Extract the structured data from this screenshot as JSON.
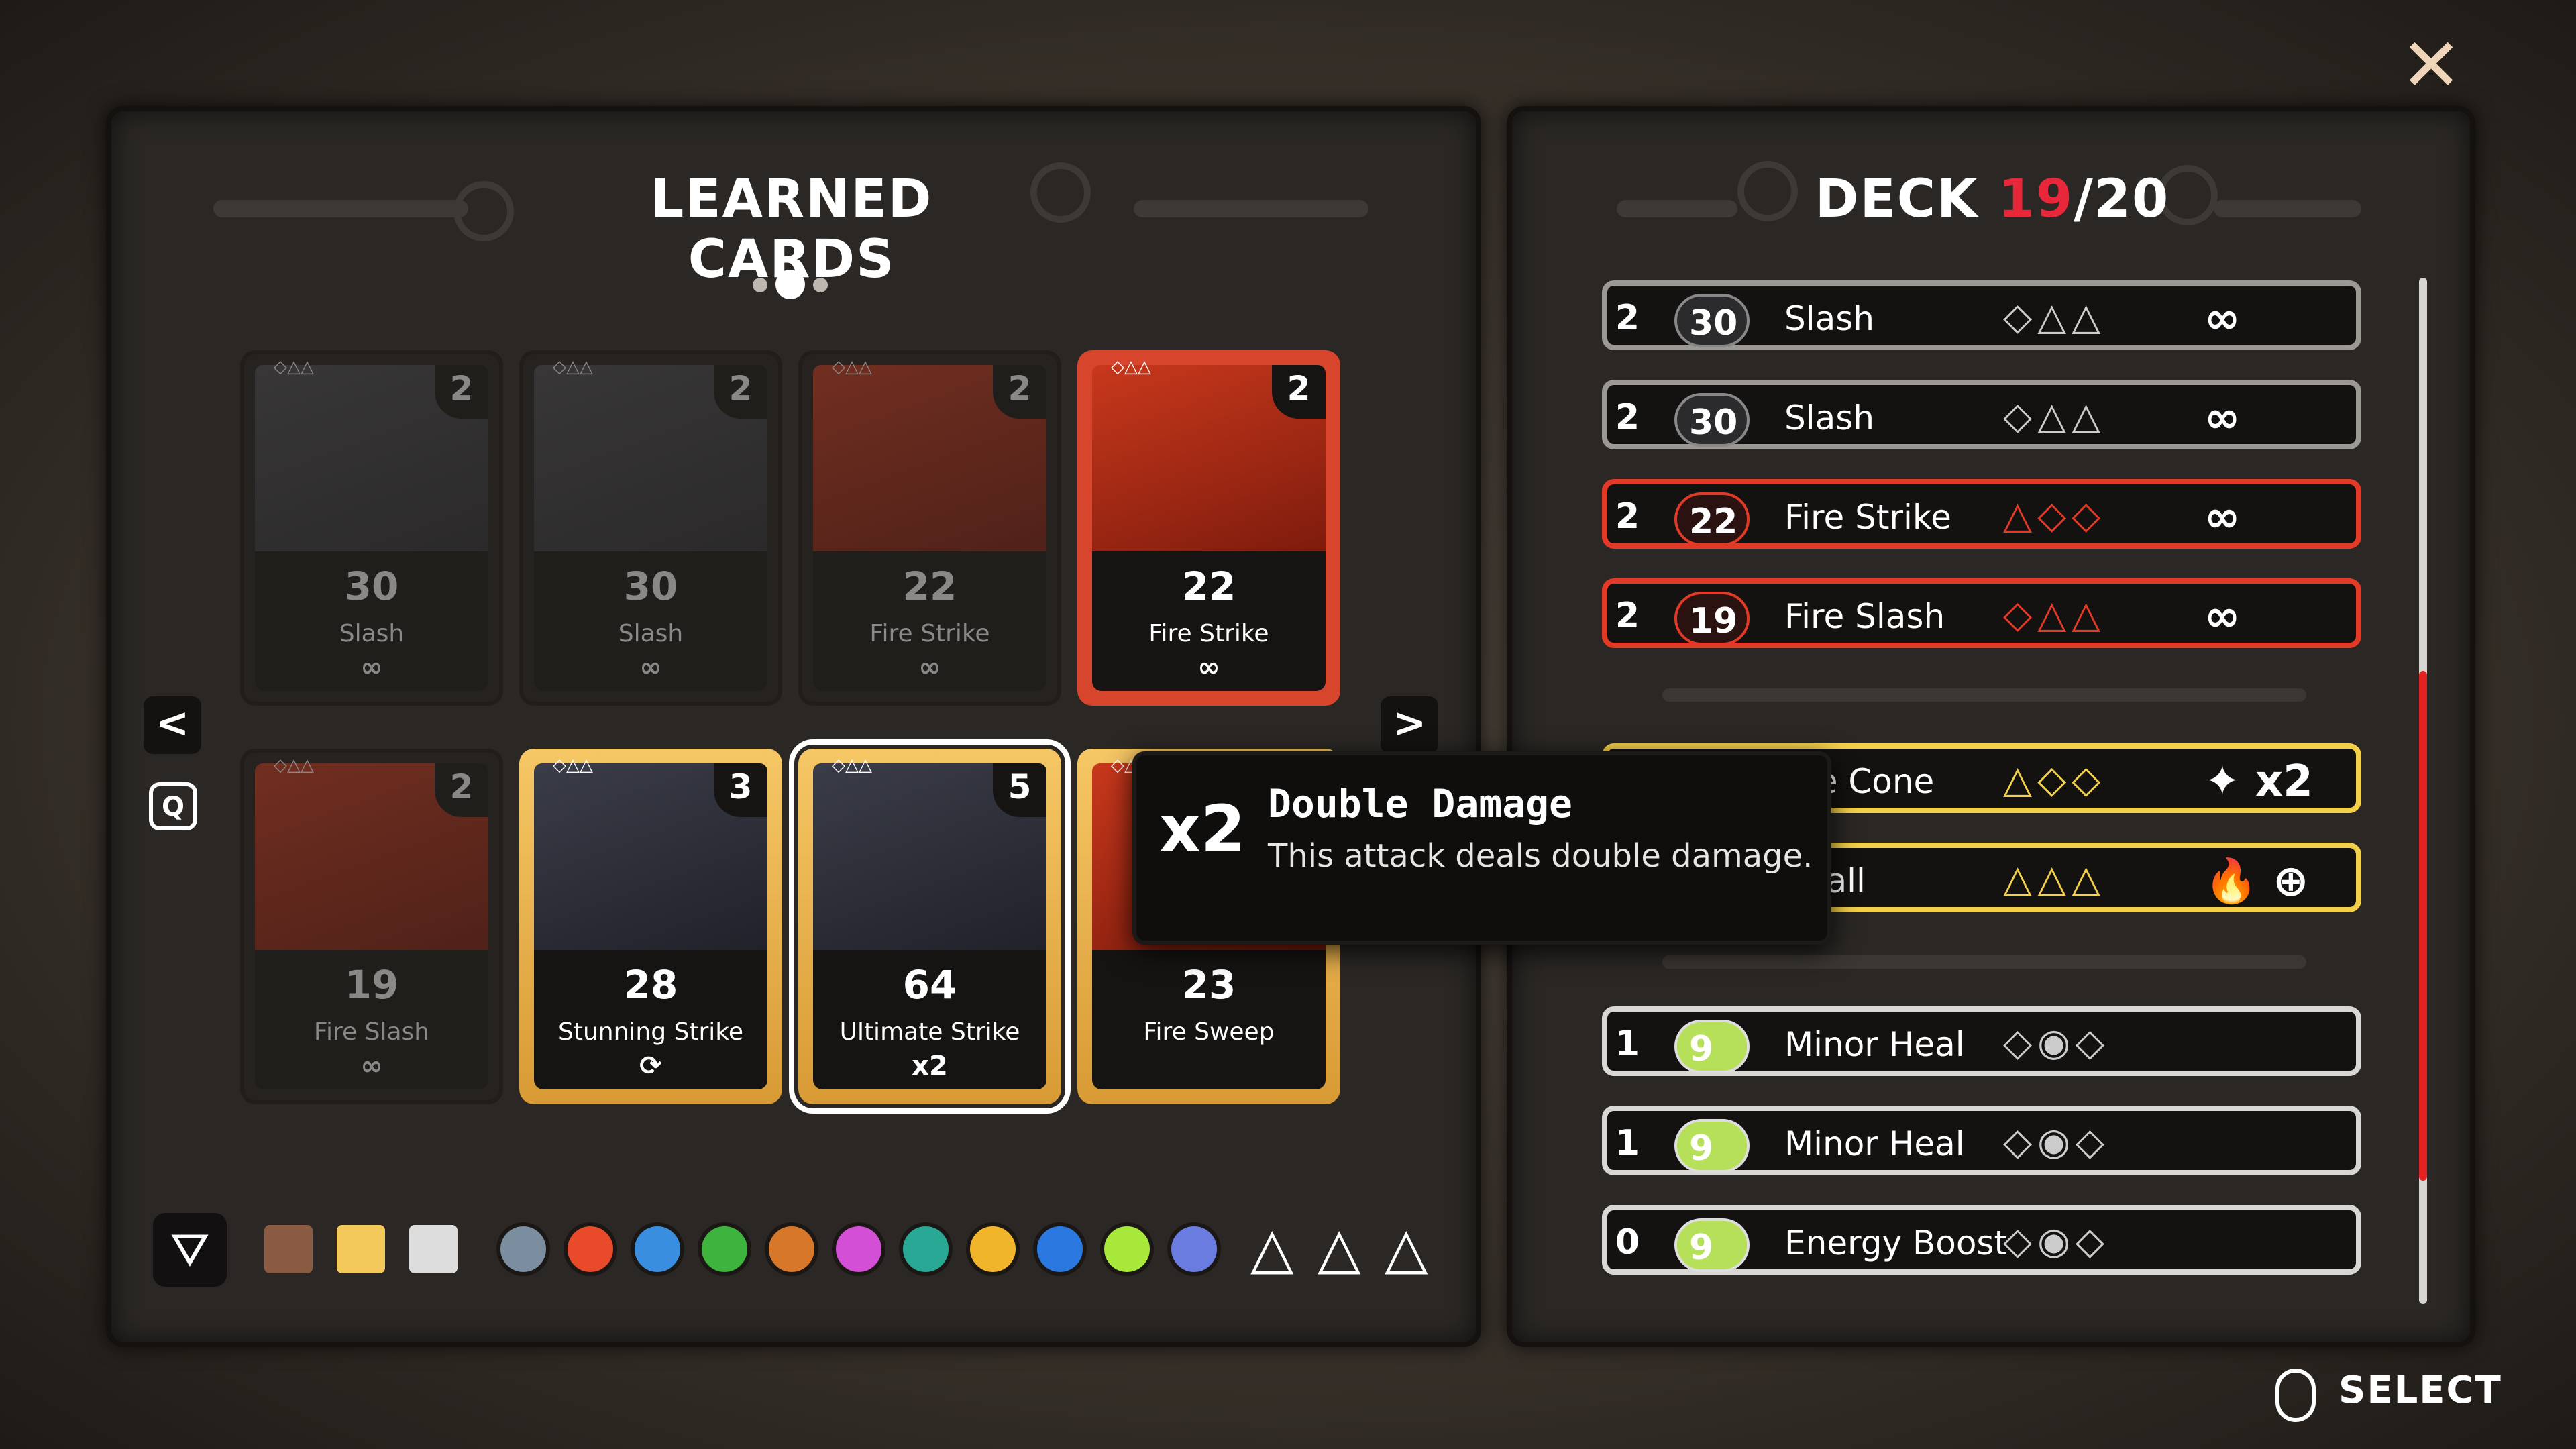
{
  "left_panel": {
    "title": "LEARNED CARDS",
    "page_dots": 3,
    "cards": [
      {
        "name": "Slash",
        "value": "30",
        "cost": "2",
        "tag": "∞",
        "theme": "gray",
        "dim": true
      },
      {
        "name": "Slash",
        "value": "30",
        "cost": "2",
        "tag": "∞",
        "theme": "gray",
        "dim": true
      },
      {
        "name": "Fire Strike",
        "value": "22",
        "cost": "2",
        "tag": "∞",
        "theme": "fire",
        "dim": true
      },
      {
        "name": "Fire Strike",
        "value": "22",
        "cost": "2",
        "tag": "∞",
        "theme": "fire",
        "dim": false
      },
      {
        "name": "Fire Slash",
        "value": "19",
        "cost": "2",
        "tag": "∞",
        "theme": "fire",
        "dim": true
      },
      {
        "name": "Stunning Strike",
        "value": "28",
        "cost": "3",
        "tag": "⟳",
        "theme": "gold",
        "dim": false
      },
      {
        "name": "Ultimate Strike",
        "value": "64",
        "cost": "5",
        "tag": "x2",
        "theme": "gold",
        "dim": false
      },
      {
        "name": "Fire Sweep",
        "value": "23",
        "cost": "",
        "tag": "",
        "theme": "goldfire",
        "dim": false
      }
    ],
    "prev_label": "<",
    "next_label": ">",
    "q_key": "Q"
  },
  "filters": {
    "rarity_colors": [
      "#8a5a42",
      "#f2c95a",
      "#dcdcdc"
    ],
    "elements": [
      {
        "icon": "sword-icon",
        "color": "#7b8ea0"
      },
      {
        "icon": "fire-icon",
        "color": "#e84a2a"
      },
      {
        "icon": "ice-icon",
        "color": "#3a8ee0"
      },
      {
        "icon": "nature-icon",
        "color": "#3eb33e"
      },
      {
        "icon": "earth-icon",
        "color": "#d7772a"
      },
      {
        "icon": "arcane-icon",
        "color": "#d34fd6"
      },
      {
        "icon": "wind-icon",
        "color": "#2aa896"
      },
      {
        "icon": "lightning-icon",
        "color": "#f0b52a"
      },
      {
        "icon": "water-icon",
        "color": "#2a78e0"
      },
      {
        "icon": "heart-icon",
        "color": "#a8e83a"
      },
      {
        "icon": "star-icon",
        "color": "#6a7ce0"
      }
    ],
    "triangles": [
      "△",
      "△",
      "△"
    ]
  },
  "deck": {
    "title_prefix": "DECK ",
    "count": "19",
    "slash_max": "/20",
    "rows": [
      {
        "cost": "2",
        "value": "30",
        "name": "Slash",
        "pips": "◇△△",
        "end": "∞",
        "style": "gray"
      },
      {
        "cost": "2",
        "value": "30",
        "name": "Slash",
        "pips": "◇△△",
        "end": "∞",
        "style": "gray"
      },
      {
        "cost": "2",
        "value": "22",
        "name": "Fire Strike",
        "pips": "△◇◇",
        "end": "∞",
        "style": "red"
      },
      {
        "cost": "2",
        "value": "19",
        "name": "Fire Slash",
        "pips": "◇△△",
        "end": "∞",
        "style": "red"
      },
      {
        "cost": "",
        "value": "",
        "name": "me Cone",
        "pips": "△◇◇",
        "end": "✦ x2",
        "style": "gold"
      },
      {
        "cost": "",
        "value": "",
        "name": "eball",
        "pips": "△△△",
        "end": "🔥 ⊕",
        "style": "gold"
      },
      {
        "cost": "1",
        "value": "9",
        "name": "Minor Heal",
        "pips": "◇◉◇",
        "end": "",
        "style": "light"
      },
      {
        "cost": "1",
        "value": "9",
        "name": "Minor Heal",
        "pips": "◇◉◇",
        "end": "",
        "style": "light"
      },
      {
        "cost": "0",
        "value": "9",
        "name": "Energy Boost",
        "pips": "◇◉◇",
        "end": "",
        "style": "light"
      }
    ]
  },
  "tooltip": {
    "badge": "x2",
    "title": "Double Damage",
    "text": "This attack deals double damage."
  },
  "close_label": "✕",
  "select_hint": "SELECT"
}
